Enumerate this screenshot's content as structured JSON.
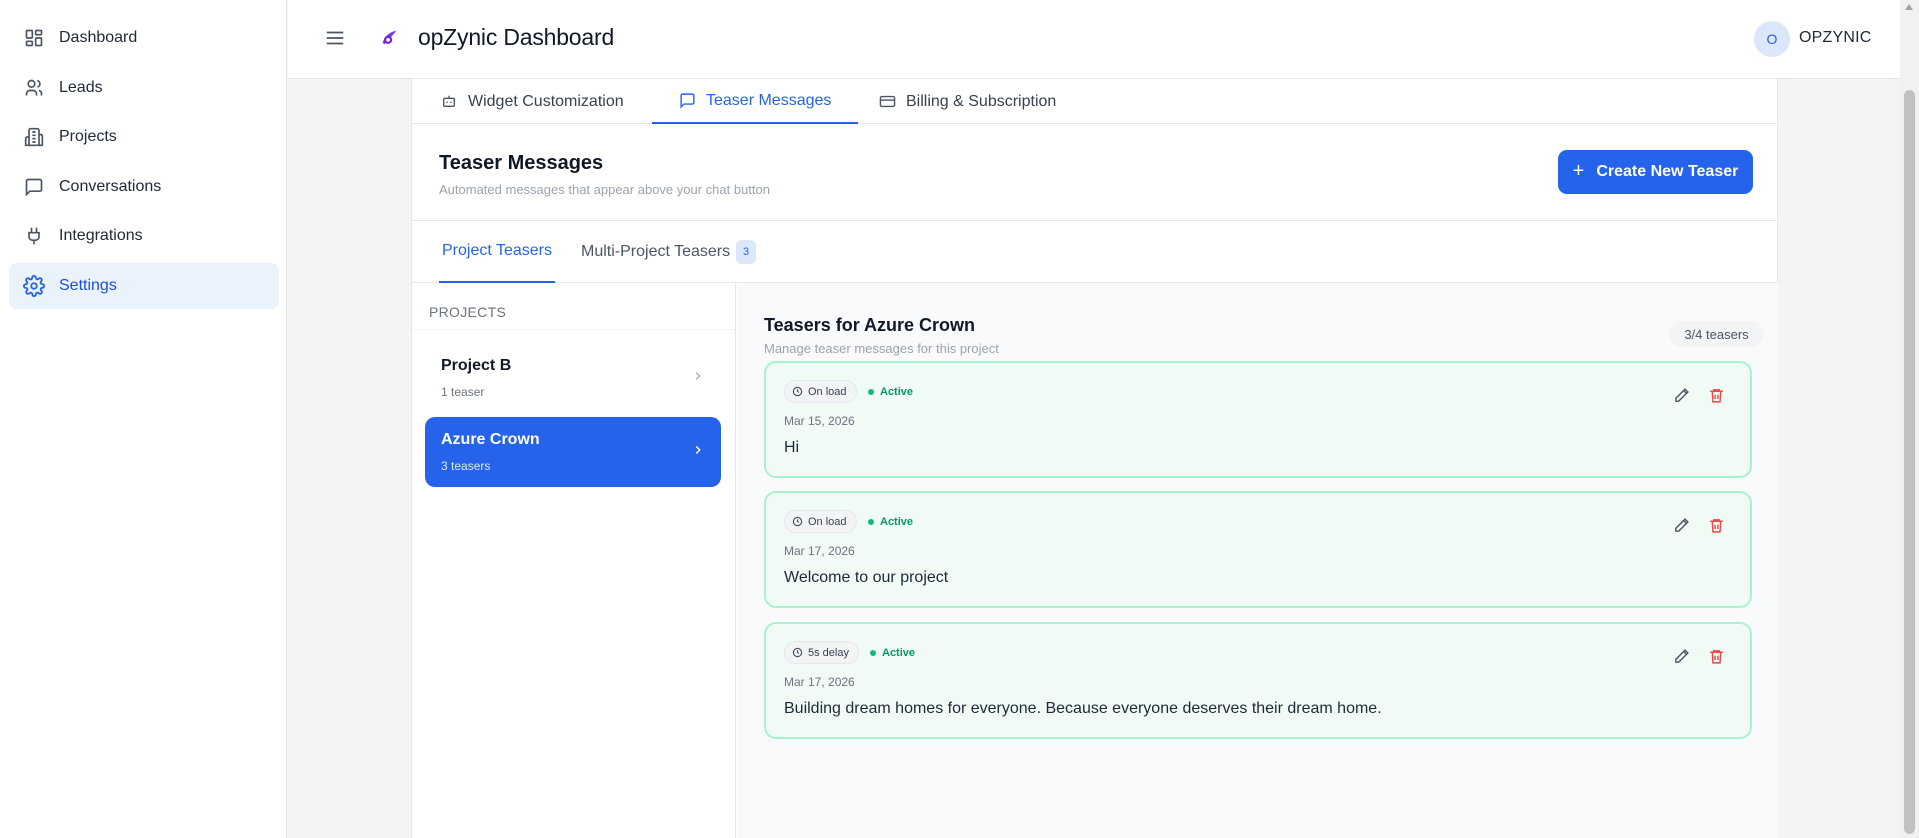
{
  "sidebar": {
    "items": [
      {
        "label": "Dashboard",
        "icon": "dashboard-grid-icon"
      },
      {
        "label": "Leads",
        "icon": "users-icon"
      },
      {
        "label": "Projects",
        "icon": "building-icon"
      },
      {
        "label": "Conversations",
        "icon": "message-square-icon"
      },
      {
        "label": "Integrations",
        "icon": "plug-icon"
      },
      {
        "label": "Settings",
        "icon": "gear-icon",
        "active": true
      }
    ]
  },
  "header": {
    "title": "opZynic Dashboard",
    "user_initial": "O",
    "user_name": "OPZYNIC"
  },
  "settings_tabs": [
    {
      "label": "Widget Customization",
      "icon": "bot-icon"
    },
    {
      "label": "Teaser Messages",
      "icon": "message-square-icon",
      "active": true
    },
    {
      "label": "Billing & Subscription",
      "icon": "credit-card-icon"
    }
  ],
  "teaser_section": {
    "title": "Teaser Messages",
    "subtitle": "Automated messages that appear above your chat button",
    "create_button": "Create New Teaser"
  },
  "sub_tabs": {
    "project": "Project Teasers",
    "multi": "Multi-Project Teasers",
    "multi_count": "3"
  },
  "projects": {
    "header": "PROJECTS",
    "items": [
      {
        "name": "Project B",
        "count": "1 teaser"
      },
      {
        "name": "Azure Crown",
        "count": "3 teasers",
        "active": true
      }
    ]
  },
  "teasers_panel": {
    "title": "Teasers for Azure Crown",
    "subtitle": "Manage teaser messages for this project",
    "badge": "3/4 teasers",
    "teasers": [
      {
        "trigger": "On load",
        "status": "Active",
        "date": "Mar 15, 2026",
        "message": "Hi"
      },
      {
        "trigger": "On load",
        "status": "Active",
        "date": "Mar 17, 2026",
        "message": "Welcome to our project"
      },
      {
        "trigger": "5s delay",
        "status": "Active",
        "date": "Mar 17, 2026",
        "message": "Building dream homes for everyone. Because everyone deserves their dream home."
      }
    ]
  },
  "colors": {
    "accent": "#2563eb",
    "active_green": "#10b981",
    "teaser_bg": "#f0fbf5",
    "teaser_border": "#a7f3d0",
    "delete_red": "#ef4444"
  }
}
